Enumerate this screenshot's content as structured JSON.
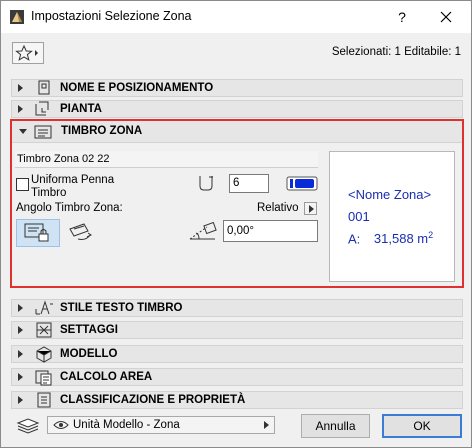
{
  "window": {
    "title": "Impostazioni Selezione Zona",
    "help": "?"
  },
  "header": {
    "selected_info": "Selezionati: 1 Editabile: 1"
  },
  "panels_top": [
    {
      "label": "NOME E POSIZIONAMENTO",
      "icon": "name-position-icon"
    },
    {
      "label": "PIANTA",
      "icon": "floor-plan-icon"
    }
  ],
  "stamp": {
    "header": "TIMBRO ZONA",
    "name": "Timbro Zona 02 22",
    "uniform_pen_label": "Uniforma Penna Timbro",
    "pen_value": "6",
    "angle_label": "Angolo Timbro Zona:",
    "relative_label": "Relativo",
    "angle_value": "0,00°",
    "pen_color": "#0a2bd8",
    "preview": {
      "name": "<Nome Zona>",
      "number": "001",
      "area_prefix": "A:",
      "area_value": "31,588 m",
      "area_sup": "2"
    }
  },
  "panels_bottom": [
    {
      "label": "STILE TESTO TIMBRO",
      "icon": "text-style-icon"
    },
    {
      "label": "SETTAGGI",
      "icon": "settings-icon"
    },
    {
      "label": "MODELLO",
      "icon": "model-icon"
    },
    {
      "label": "CALCOLO AREA",
      "icon": "area-calc-icon"
    },
    {
      "label": "CLASSIFICAZIONE E PROPRIETÀ",
      "icon": "classification-icon"
    }
  ],
  "footer": {
    "layer": "Unità Modello - Zona",
    "cancel": "Annulla",
    "ok": "OK"
  },
  "colors": {
    "highlight_border": "#e03030",
    "preview_text": "#1a2fb0",
    "ok_border": "#3a7dd6"
  }
}
